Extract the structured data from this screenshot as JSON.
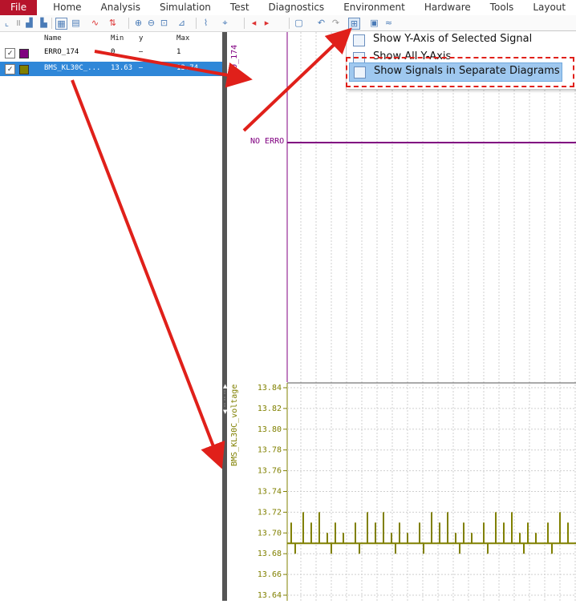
{
  "menu": {
    "file": "File",
    "items": [
      "Home",
      "Analysis",
      "Simulation",
      "Test",
      "Diagnostics",
      "Environment",
      "Hardware",
      "Tools",
      "Layout"
    ]
  },
  "dropdown": {
    "items": [
      {
        "label": "Show Y-Axis of Selected Signal"
      },
      {
        "label": "Show All Y-Axis"
      },
      {
        "label": "Show Signals in Separate Diagrams"
      }
    ]
  },
  "signal_table": {
    "headers": {
      "name": "Name",
      "min": "Min",
      "y": "y",
      "max": "Max"
    },
    "rows": [
      {
        "name": "ERRO_174",
        "min": "0",
        "y": "–",
        "max": "1",
        "color": "#800080",
        "checked": true,
        "selected": false
      },
      {
        "name": "BMS_KL30C_...",
        "min": "13.63",
        "y": "–",
        "max": "13.74",
        "color": "#808000",
        "checked": true,
        "selected": true
      }
    ]
  },
  "plot_top": {
    "axis_label": "ERRO_174",
    "value_label": "NO ERRO",
    "color": "#800080"
  },
  "plot_bottom": {
    "axis_label": "BMS_KL30C_voltage",
    "color": "#808000"
  },
  "chart_data": {
    "type": "line",
    "series": [
      {
        "name": "BMS_KL30C_voltage",
        "values": [
          13.69,
          13.71,
          13.68,
          13.69,
          13.72,
          13.69,
          13.71,
          13.69,
          13.72,
          13.69,
          13.7,
          13.68,
          13.71,
          13.69,
          13.7,
          13.69
        ]
      }
    ],
    "yticks": [
      "13.84",
      "13.82",
      "13.80",
      "13.78",
      "13.76",
      "13.74",
      "13.72",
      "13.70",
      "13.68",
      "13.66",
      "13.64"
    ],
    "ylim": [
      13.64,
      13.84
    ],
    "grid": true
  },
  "accent_color": "#e0201a"
}
